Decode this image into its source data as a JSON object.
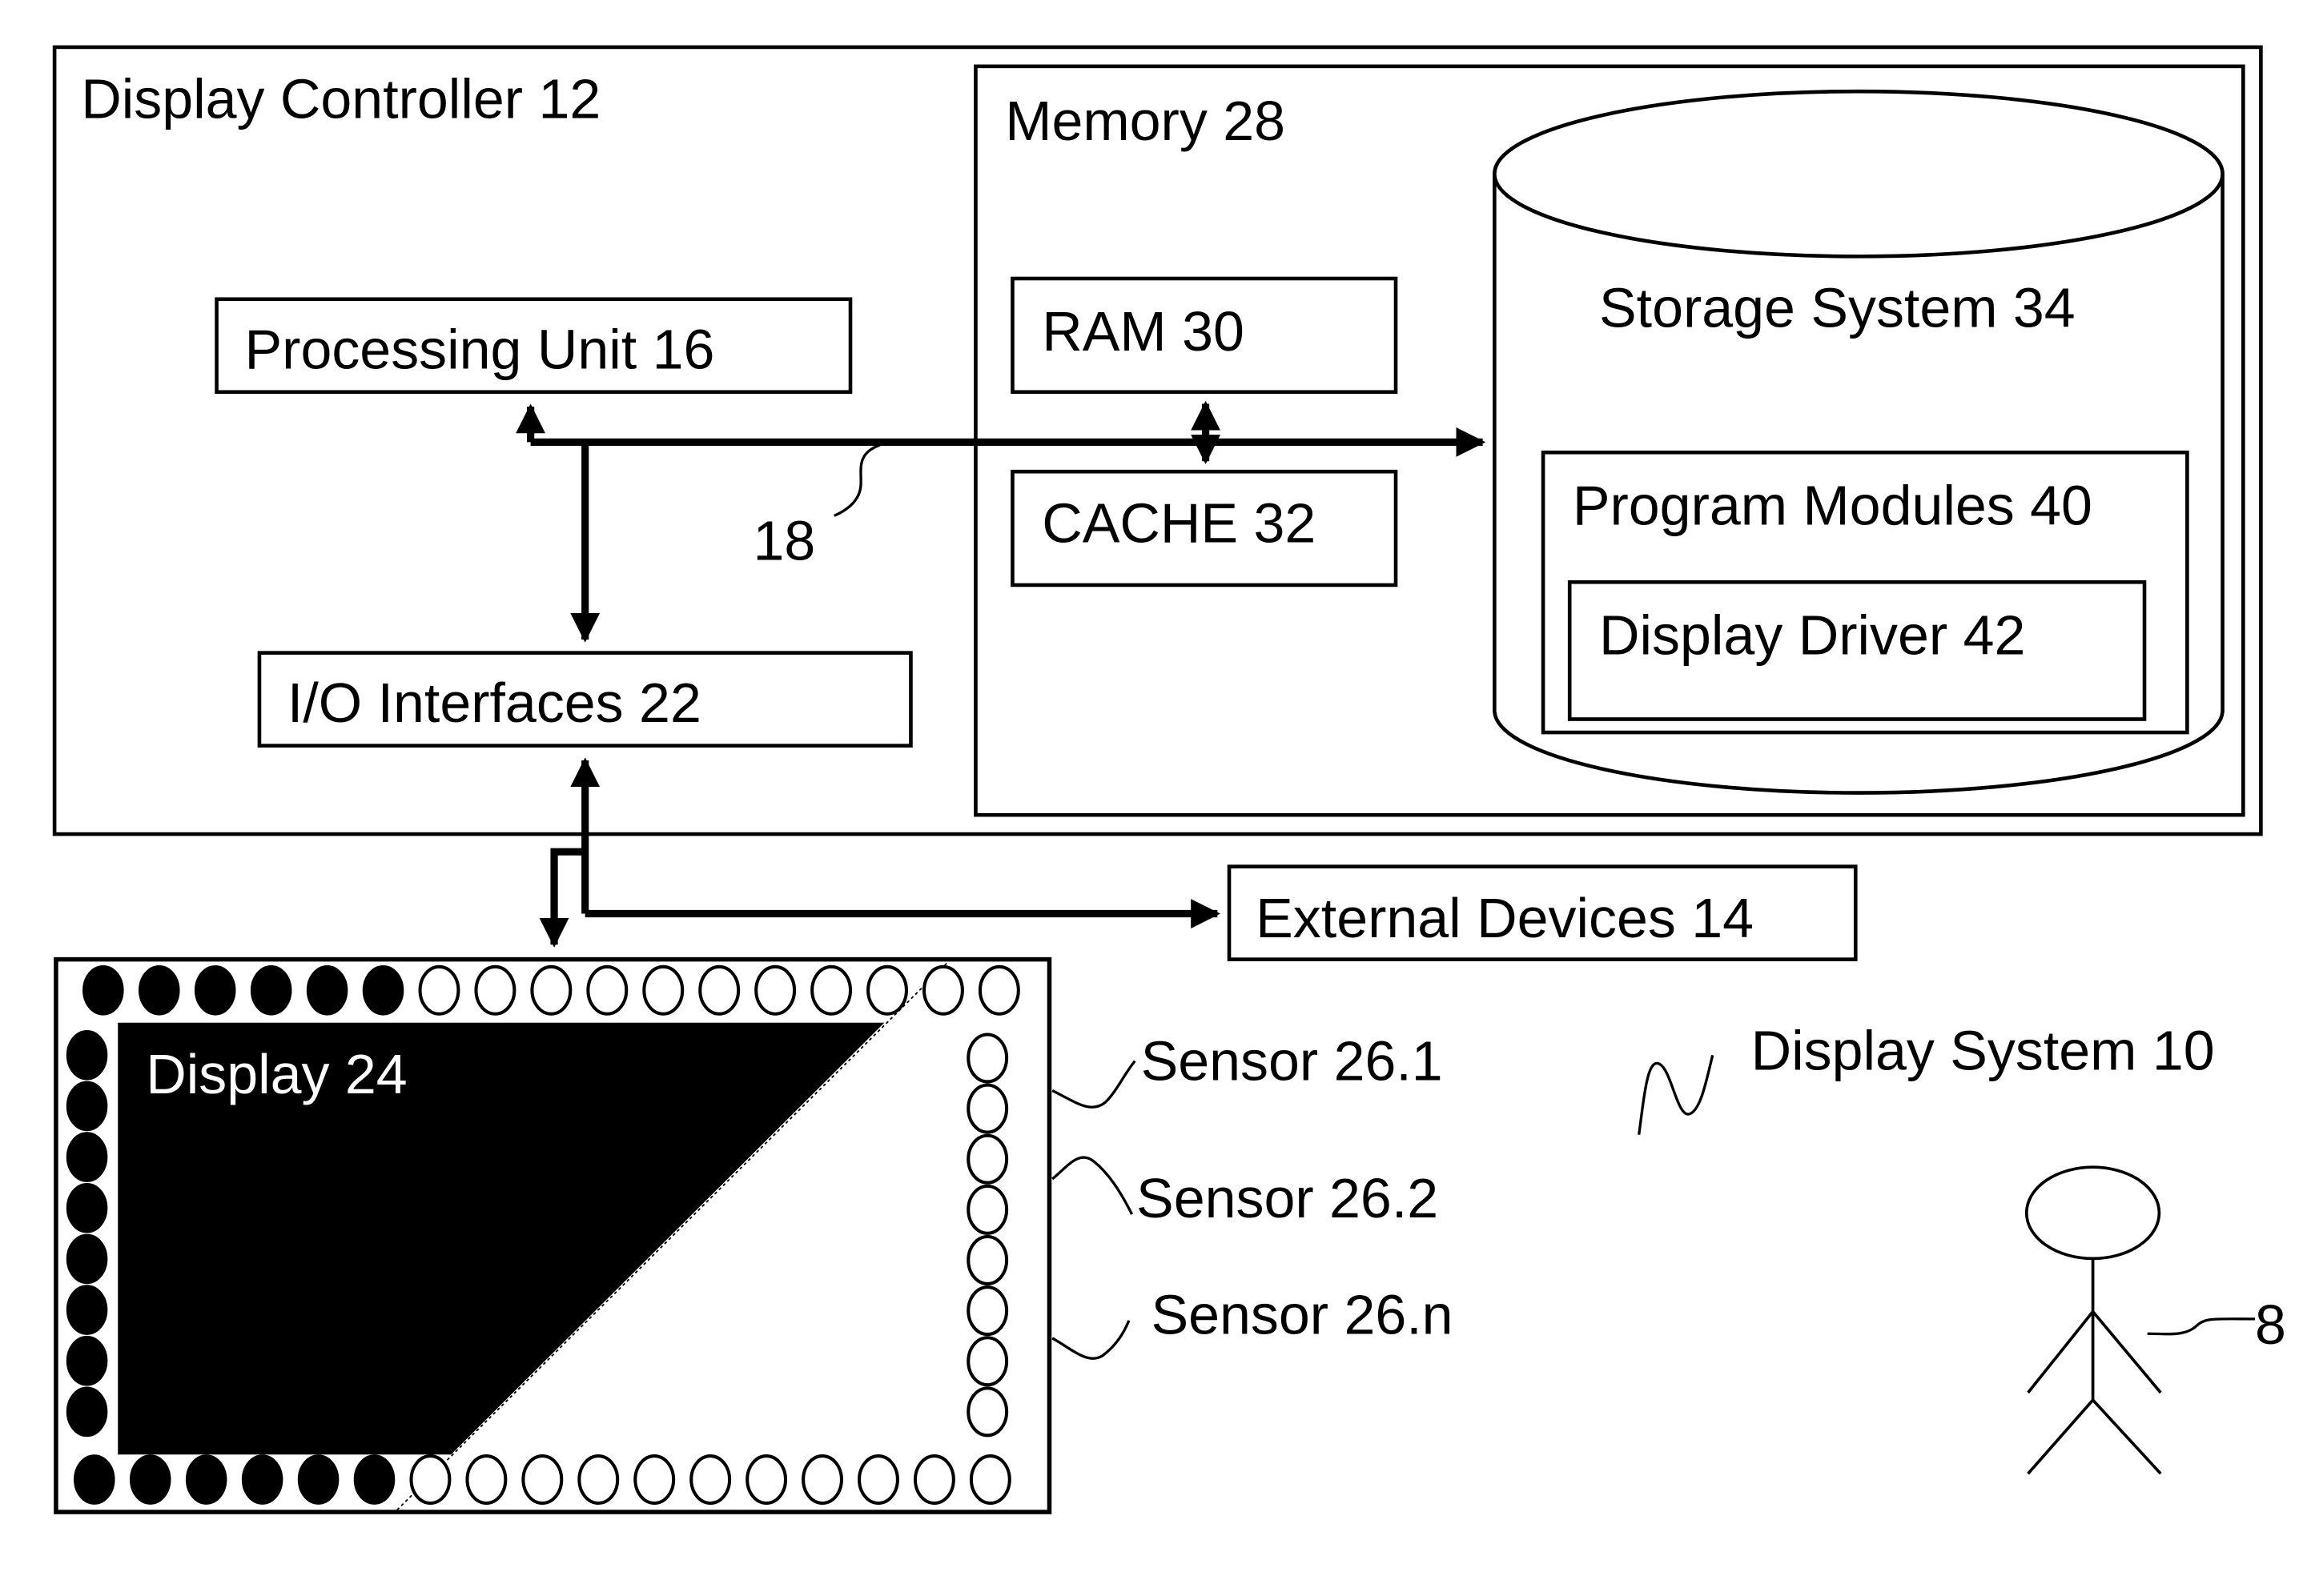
{
  "figure": {
    "display_controller": {
      "label": "Display Controller 12"
    },
    "processing_unit": {
      "label": "Processing Unit 16"
    },
    "bus": {
      "label": "18"
    },
    "io_interfaces": {
      "label": "I/O Interfaces 22"
    },
    "memory": {
      "label": "Memory 28"
    },
    "ram": {
      "label": "RAM 30"
    },
    "cache": {
      "label": "CACHE 32"
    },
    "storage_system": {
      "label": "Storage System 34"
    },
    "program_modules": {
      "label": "Program Modules 40"
    },
    "display_driver": {
      "label": "Display Driver 42"
    },
    "external_devices": {
      "label": "External Devices 14"
    },
    "display": {
      "label": "Display 24",
      "sensors": {
        "top_row": {
          "active": 6,
          "inactive": 11
        },
        "bottom_row": {
          "active": 6,
          "inactive": 11
        },
        "left_column": {
          "active": 8,
          "inactive": 0
        },
        "right_column": {
          "active": 0,
          "inactive": 8
        }
      }
    },
    "sensor_labels": [
      "Sensor 26.1",
      "Sensor 26.2",
      "Sensor 26.n"
    ],
    "display_system": {
      "label": "Display System 10"
    },
    "user": {
      "label": "8"
    }
  }
}
